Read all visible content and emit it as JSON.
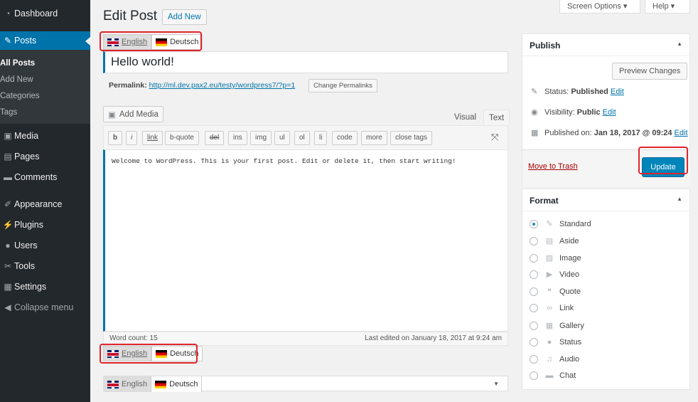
{
  "sidebar": {
    "menu": [
      {
        "label": "Dashboard",
        "icon": "dashboard-icon",
        "glyph": "◔"
      },
      {
        "label": "Posts",
        "icon": "pin-icon",
        "glyph": "✎"
      },
      {
        "label": "Media",
        "icon": "media-icon",
        "glyph": "▣"
      },
      {
        "label": "Pages",
        "icon": "pages-icon",
        "glyph": "▤"
      },
      {
        "label": "Comments",
        "icon": "comments-icon",
        "glyph": "▬"
      },
      {
        "label": "Appearance",
        "icon": "brush-icon",
        "glyph": "✐"
      },
      {
        "label": "Plugins",
        "icon": "plugin-icon",
        "glyph": "⚡"
      },
      {
        "label": "Users",
        "icon": "users-icon",
        "glyph": "●"
      },
      {
        "label": "Tools",
        "icon": "wrench-icon",
        "glyph": "✂"
      },
      {
        "label": "Settings",
        "icon": "settings-icon",
        "glyph": "▦"
      },
      {
        "label": "Collapse menu",
        "icon": "collapse-icon",
        "glyph": "◀"
      }
    ],
    "submenu": [
      "All Posts",
      "Add New",
      "Categories",
      "Tags"
    ]
  },
  "header": {
    "title": "Edit Post",
    "add_new": "Add New",
    "screen_options": "Screen Options ▾",
    "help": "Help ▾"
  },
  "languages": {
    "english": "English",
    "deutsch": "Deutsch"
  },
  "post": {
    "title": "Hello world!",
    "permalink_label": "Permalink:",
    "permalink_url": "http://ml.dev.pax2.eu/testy/wordpress7/?p=1",
    "change_permalinks": "Change Permalinks",
    "content": "Welcome to WordPress. This is your first post. Edit or delete it, then start writing!"
  },
  "editor": {
    "add_media": "Add Media",
    "tab_visual": "Visual",
    "tab_text": "Text",
    "quicktags": [
      "b",
      "i",
      "link",
      "b-quote",
      "del",
      "ins",
      "img",
      "ul",
      "ol",
      "li",
      "code",
      "more",
      "close tags"
    ],
    "word_count": "Word count: 15",
    "last_edited": "Last edited on January 18, 2017 at 9:24 am"
  },
  "publish": {
    "title": "Publish",
    "preview": "Preview Changes",
    "status_label": "Status:",
    "status_value": "Published",
    "visibility_label": "Visibility:",
    "visibility_value": "Public",
    "published_label": "Published on:",
    "published_value": "Jan 18, 2017 @ 09:24",
    "edit": "Edit",
    "trash": "Move to Trash",
    "update": "Update"
  },
  "format": {
    "title": "Format",
    "options": [
      {
        "label": "Standard",
        "icon": "pin-icon",
        "glyph": "✎"
      },
      {
        "label": "Aside",
        "icon": "aside-icon",
        "glyph": "▤"
      },
      {
        "label": "Image",
        "icon": "image-icon",
        "glyph": "▨"
      },
      {
        "label": "Video",
        "icon": "video-icon",
        "glyph": "▶"
      },
      {
        "label": "Quote",
        "icon": "quote-icon",
        "glyph": "❝"
      },
      {
        "label": "Link",
        "icon": "link-icon",
        "glyph": "∞"
      },
      {
        "label": "Gallery",
        "icon": "gallery-icon",
        "glyph": "▦"
      },
      {
        "label": "Status",
        "icon": "status-icon",
        "glyph": "●"
      },
      {
        "label": "Audio",
        "icon": "audio-icon",
        "glyph": "♫"
      },
      {
        "label": "Chat",
        "icon": "chat-icon",
        "glyph": "▬"
      }
    ],
    "selected": "Standard"
  }
}
